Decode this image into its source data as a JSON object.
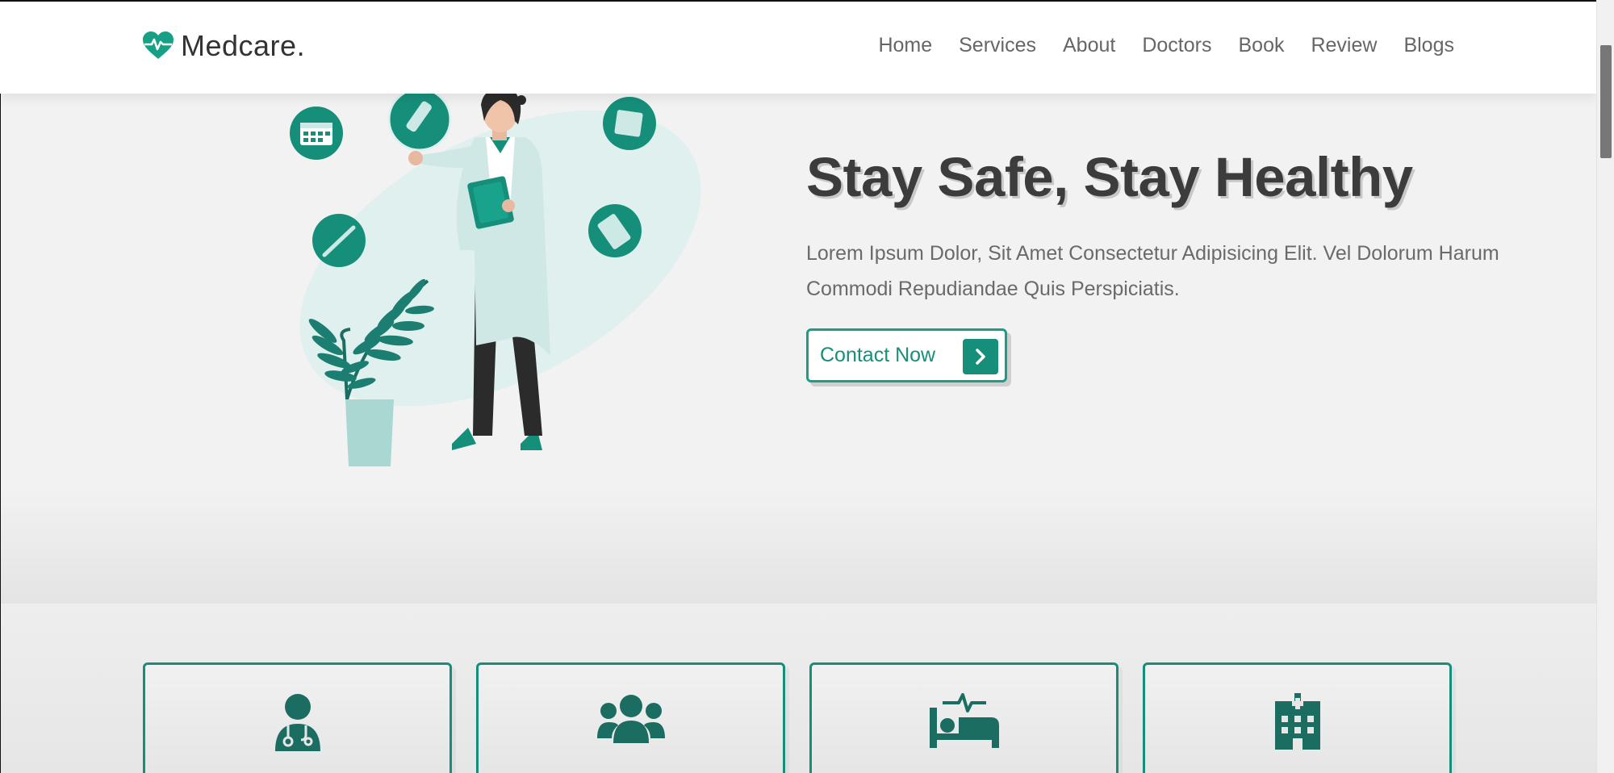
{
  "brand": {
    "name": "Medcare.",
    "icon": "heart-pulse-icon",
    "accent": "#16a085"
  },
  "nav": {
    "items": [
      "Home",
      "Services",
      "About",
      "Doctors",
      "Book",
      "Review",
      "Blogs"
    ]
  },
  "hero": {
    "title": "Stay Safe, Stay Healthy",
    "text": "Lorem Ipsum Dolor, Sit Amet Consectetur Adipisicing Elit. Vel Dolorum Harum Commodi Repudiandae Quis Perspiciatis.",
    "cta_label": "Contact Now",
    "cta_icon": "chevron-right-icon",
    "illustration": "doctor-with-medical-icons-illustration"
  },
  "features": [
    {
      "icon": "user-doctor-icon"
    },
    {
      "icon": "users-group-icon"
    },
    {
      "icon": "hospital-bed-icon"
    },
    {
      "icon": "hospital-building-icon"
    }
  ],
  "colors": {
    "accent": "#16a085",
    "accent_dark": "#168f7a",
    "title": "#3c3c3c",
    "text": "#6a6a6a"
  }
}
